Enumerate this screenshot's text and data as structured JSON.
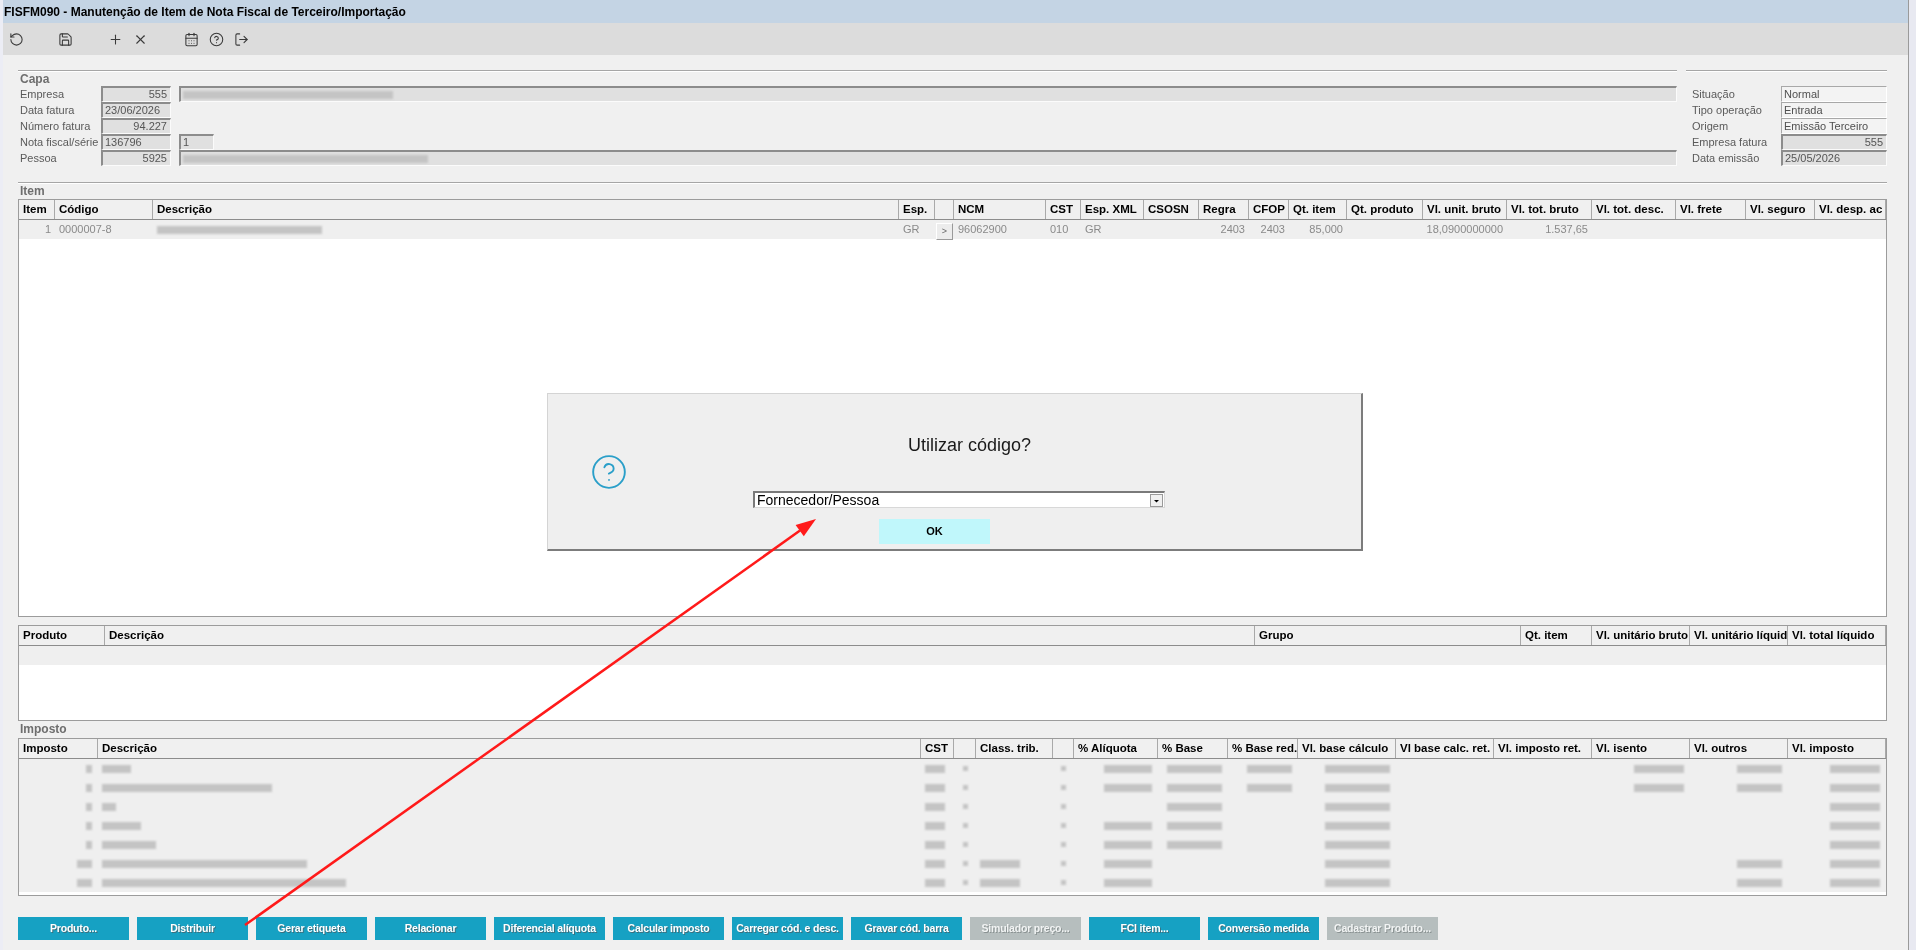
{
  "window": {
    "title": "FISFM090 - Manutenção de Item de Nota Fiscal de Terceiro/Importação"
  },
  "capa": {
    "title": "Capa",
    "rows": [
      {
        "label": "Empresa",
        "fields": [
          {
            "kind": "number",
            "value": "555",
            "disabled": true
          },
          {
            "kind": "redacted",
            "disabled": true
          }
        ]
      },
      {
        "label": "Data fatura",
        "fields": [
          {
            "kind": "text",
            "value": "23/06/2026",
            "disabled": true
          }
        ]
      },
      {
        "label": "Número fatura",
        "fields": [
          {
            "kind": "number",
            "value": "94.227",
            "disabled": true
          }
        ]
      },
      {
        "label": "Nota fiscal/série",
        "fields": [
          {
            "kind": "text",
            "value": "136796",
            "disabled": true
          },
          {
            "kind": "text",
            "value": "1",
            "disabled": true
          }
        ]
      },
      {
        "label": "Pessoa",
        "fields": [
          {
            "kind": "number",
            "value": "5925",
            "disabled": true
          },
          {
            "kind": "redacted",
            "disabled": true
          }
        ]
      }
    ]
  },
  "status_fields": [
    {
      "label": "Situação",
      "kind": "text",
      "value": "Normal",
      "disabled": false
    },
    {
      "label": "Tipo operação",
      "kind": "text",
      "value": "Entrada",
      "disabled": false
    },
    {
      "label": "Origem",
      "kind": "text",
      "value": "Emissão Terceiro",
      "disabled": false
    },
    {
      "label": "Empresa fatura",
      "kind": "number",
      "value": "555",
      "disabled": true
    },
    {
      "label": "Data emissão",
      "kind": "text",
      "value": "25/05/2026",
      "disabled": true
    }
  ],
  "item": {
    "title": "Item",
    "columns": [
      {
        "kind": "text",
        "label": "Item"
      },
      {
        "kind": "text",
        "label": "Código"
      },
      {
        "kind": "text",
        "label": "Descrição"
      },
      {
        "kind": "text",
        "label": "Esp."
      },
      {
        "kind": "blank"
      },
      {
        "kind": "text",
        "label": "NCM"
      },
      {
        "kind": "text",
        "label": "CST"
      },
      {
        "kind": "text",
        "label": "Esp. XML"
      },
      {
        "kind": "text",
        "label": "CSOSN"
      },
      {
        "kind": "text",
        "label": "Regra"
      },
      {
        "kind": "text",
        "label": "CFOP"
      },
      {
        "kind": "text",
        "label": "Qt. item"
      },
      {
        "kind": "text",
        "label": "Qt. produto"
      },
      {
        "kind": "text",
        "label": "Vl. unit. bruto"
      },
      {
        "kind": "text",
        "label": "Vl. tot. bruto"
      },
      {
        "kind": "text",
        "label": "Vl. tot. desc."
      },
      {
        "kind": "text",
        "label": "Vl. frete"
      },
      {
        "kind": "text",
        "label": "Vl. seguro"
      },
      {
        "kind": "text",
        "label": "Vl. desp. ac"
      }
    ],
    "rows": [
      {
        "cells": [
          {
            "kind": "number",
            "value": "1"
          },
          {
            "kind": "text",
            "value": "0000007-8"
          },
          {
            "kind": "redacted"
          },
          {
            "kind": "text",
            "value": "GR"
          },
          {
            "kind": "button",
            "value": ">"
          },
          {
            "kind": "text",
            "value": "96062900"
          },
          {
            "kind": "text",
            "value": "010"
          },
          {
            "kind": "text",
            "value": "GR"
          },
          null,
          {
            "kind": "number",
            "value": "2403"
          },
          {
            "kind": "number",
            "value": "2403"
          },
          {
            "kind": "number",
            "value": "85,000"
          },
          null,
          {
            "kind": "number",
            "value": "18,0900000000"
          },
          {
            "kind": "number",
            "value": "1.537,65"
          },
          null,
          null,
          null,
          null
        ]
      }
    ]
  },
  "produto": {
    "columns": [
      {
        "kind": "text",
        "label": "Produto"
      },
      {
        "kind": "text",
        "label": "Descrição"
      },
      {
        "kind": "text",
        "label": "Grupo"
      },
      {
        "kind": "text",
        "label": "Qt. item"
      },
      {
        "kind": "text",
        "label": "Vl. unitário bruto"
      },
      {
        "kind": "text",
        "label": "Vl. unitário líquid"
      },
      {
        "kind": "text",
        "label": "Vl. total líquido"
      }
    ]
  },
  "imposto": {
    "title": "Imposto",
    "columns": [
      {
        "kind": "text",
        "label": "Imposto"
      },
      {
        "kind": "text",
        "label": "Descrição"
      },
      {
        "kind": "text",
        "label": "CST"
      },
      {
        "kind": "blank"
      },
      {
        "kind": "text",
        "label": "Class. trib."
      },
      {
        "kind": "blank"
      },
      {
        "kind": "text",
        "label": "% Alíquota"
      },
      {
        "kind": "text",
        "label": "% Base"
      },
      {
        "kind": "text",
        "label": "% Base red."
      },
      {
        "kind": "text",
        "label": "Vl. base cálculo"
      },
      {
        "kind": "text",
        "label": "Vl base calc. ret."
      },
      {
        "kind": "text",
        "label": "Vl. imposto ret."
      },
      {
        "kind": "text",
        "label": "Vl. isento"
      },
      {
        "kind": "text",
        "label": "Vl. outros"
      },
      {
        "kind": "text",
        "label": "Vl. imposto"
      }
    ],
    "rows": [
      {
        "cells": [
          {
            "kind": "redacted"
          },
          {
            "kind": "redacted"
          },
          {
            "kind": "redacted"
          },
          {
            "kind": "redacted"
          },
          null,
          {
            "kind": "redacted"
          },
          {
            "kind": "redacted"
          },
          {
            "kind": "redacted"
          },
          {
            "kind": "redacted"
          },
          {
            "kind": "redacted"
          },
          null,
          null,
          {
            "kind": "redacted"
          },
          {
            "kind": "redacted"
          },
          {
            "kind": "redacted"
          }
        ]
      },
      {
        "cells": [
          {
            "kind": "redacted"
          },
          {
            "kind": "redacted"
          },
          {
            "kind": "redacted"
          },
          {
            "kind": "redacted"
          },
          null,
          {
            "kind": "redacted"
          },
          {
            "kind": "redacted"
          },
          {
            "kind": "redacted"
          },
          {
            "kind": "redacted"
          },
          {
            "kind": "redacted"
          },
          null,
          null,
          {
            "kind": "redacted"
          },
          {
            "kind": "redacted"
          },
          {
            "kind": "redacted"
          }
        ]
      },
      {
        "cells": [
          {
            "kind": "redacted"
          },
          {
            "kind": "redacted"
          },
          {
            "kind": "redacted"
          },
          {
            "kind": "redacted"
          },
          null,
          {
            "kind": "redacted"
          },
          null,
          {
            "kind": "redacted"
          },
          null,
          {
            "kind": "redacted"
          },
          null,
          null,
          null,
          null,
          {
            "kind": "redacted"
          }
        ]
      },
      {
        "cells": [
          {
            "kind": "redacted"
          },
          {
            "kind": "redacted"
          },
          {
            "kind": "redacted"
          },
          {
            "kind": "redacted"
          },
          null,
          {
            "kind": "redacted"
          },
          {
            "kind": "redacted"
          },
          {
            "kind": "redacted"
          },
          null,
          {
            "kind": "redacted"
          },
          null,
          null,
          null,
          null,
          {
            "kind": "redacted"
          }
        ]
      },
      {
        "cells": [
          {
            "kind": "redacted"
          },
          {
            "kind": "redacted"
          },
          {
            "kind": "redacted"
          },
          {
            "kind": "redacted"
          },
          null,
          {
            "kind": "redacted"
          },
          {
            "kind": "redacted"
          },
          {
            "kind": "redacted"
          },
          null,
          {
            "kind": "redacted"
          },
          null,
          null,
          null,
          null,
          {
            "kind": "redacted"
          }
        ]
      },
      {
        "cells": [
          {
            "kind": "redacted"
          },
          {
            "kind": "redacted"
          },
          {
            "kind": "redacted"
          },
          {
            "kind": "redacted"
          },
          {
            "kind": "redacted"
          },
          {
            "kind": "redacted"
          },
          {
            "kind": "redacted"
          },
          null,
          null,
          {
            "kind": "redacted"
          },
          null,
          null,
          null,
          {
            "kind": "redacted"
          },
          {
            "kind": "redacted"
          }
        ]
      },
      {
        "cells": [
          {
            "kind": "redacted"
          },
          {
            "kind": "redacted"
          },
          {
            "kind": "redacted"
          },
          {
            "kind": "redacted"
          },
          {
            "kind": "redacted"
          },
          {
            "kind": "redacted"
          },
          {
            "kind": "redacted"
          },
          null,
          null,
          {
            "kind": "redacted"
          },
          null,
          null,
          null,
          {
            "kind": "redacted"
          },
          {
            "kind": "redacted"
          }
        ]
      }
    ]
  },
  "buttons": [
    {
      "label": "Produto...",
      "disabled": false
    },
    {
      "label": "Distribuir",
      "disabled": false
    },
    {
      "label": "Gerar etiqueta",
      "disabled": false
    },
    {
      "label": "Relacionar",
      "disabled": false
    },
    {
      "label": "Diferencial alíquota",
      "disabled": false
    },
    {
      "label": "Calcular imposto",
      "disabled": false
    },
    {
      "label": "Carregar cód. e desc.",
      "disabled": false
    },
    {
      "label": "Gravar cód. barra",
      "disabled": false
    },
    {
      "label": "Simulador preço...",
      "disabled": true
    },
    {
      "label": "FCI item...",
      "disabled": false
    },
    {
      "label": "Conversão medida",
      "disabled": false
    },
    {
      "label": "Cadastrar Produto...",
      "disabled": true
    }
  ],
  "dialog": {
    "title": "Utilizar código?",
    "select": {
      "value": "Fornecedor/Pessoa"
    },
    "button": {
      "label": "OK"
    }
  },
  "annotations": [
    {
      "kind": "arrow"
    }
  ]
}
